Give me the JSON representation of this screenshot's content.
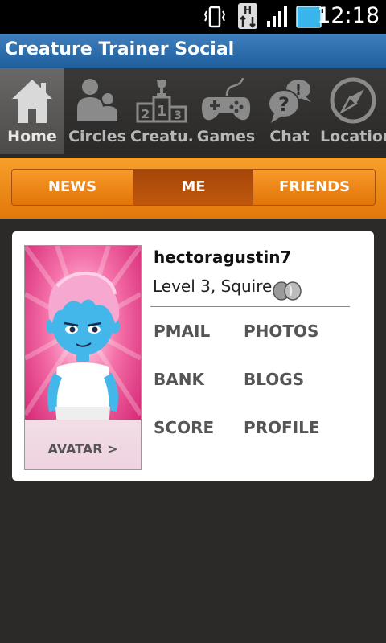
{
  "status_bar": {
    "time": "12:18",
    "icons": [
      "vibrate-icon",
      "hspa-data-icon",
      "signal-icon",
      "battery-icon"
    ]
  },
  "title_bar": {
    "title": "Creature Trainer Social"
  },
  "nav": {
    "items": [
      {
        "label": "Home",
        "icon": "home-icon",
        "active": true
      },
      {
        "label": "Circles",
        "icon": "circles-icon",
        "active": false
      },
      {
        "label": "Creatu...",
        "icon": "creatures-podium-icon",
        "active": false
      },
      {
        "label": "Games",
        "icon": "gamepad-icon",
        "active": false
      },
      {
        "label": "Chat",
        "icon": "chat-icon",
        "active": false
      },
      {
        "label": "Location",
        "icon": "compass-icon",
        "active": false
      }
    ]
  },
  "tabs": {
    "items": [
      {
        "label": "NEWS",
        "active": false
      },
      {
        "label": "ME",
        "active": true
      },
      {
        "label": "FRIENDS",
        "active": false
      }
    ]
  },
  "profile": {
    "username": "hectoragustin7",
    "level_text": "Level 3, Squire",
    "avatar_label": "AVATAR >",
    "links": {
      "pmail": "PMAIL",
      "photos": "PHOTOS",
      "bank": "BANK",
      "blogs": "BLOGS",
      "score": "SCORE",
      "profile": "PROFILE"
    }
  },
  "colors": {
    "title_bar": "#2f70b0",
    "accent_orange": "#f08a1b",
    "active_tab": "#b44f0b",
    "background": "#2b2a29"
  }
}
